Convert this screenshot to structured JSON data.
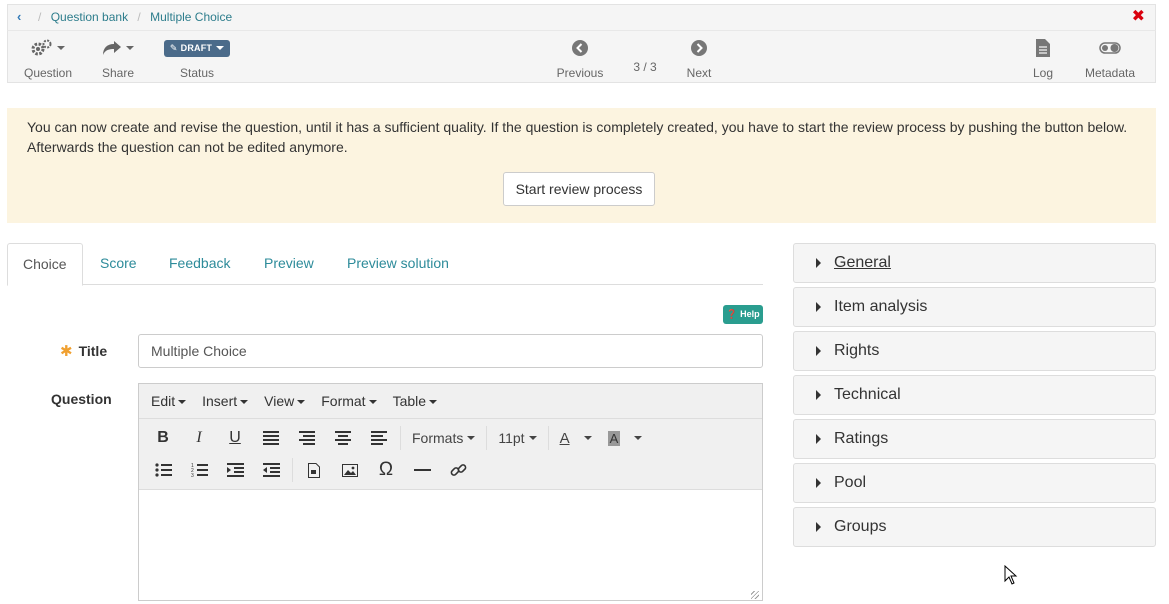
{
  "breadcrumb": {
    "items": [
      "Question bank",
      "Multiple Choice"
    ],
    "separator": "/"
  },
  "toolbar": {
    "question_label": "Question",
    "share_label": "Share",
    "status_badge": "DRAFT",
    "status_label": "Status",
    "previous_label": "Previous",
    "pager": "3 / 3",
    "next_label": "Next",
    "log_label": "Log",
    "metadata_label": "Metadata"
  },
  "notice": {
    "text": "You can now create and revise the question, until it has a sufficient quality. If the question is completely created, you have to start the review process by pushing the button below. Afterwards the question can not be edited anymore.",
    "button_label": "Start review process"
  },
  "tabs": [
    "Choice",
    "Score",
    "Feedback",
    "Preview",
    "Preview solution"
  ],
  "active_tab": "Choice",
  "help_label": "Help",
  "form": {
    "title_label": "Title",
    "title_value": "Multiple Choice",
    "question_label": "Question"
  },
  "editor": {
    "menus": [
      "Edit",
      "Insert",
      "View",
      "Format",
      "Table"
    ],
    "formats_label": "Formats",
    "font_size": "11pt",
    "font_color_glyph": "A",
    "bg_color_glyph": "A"
  },
  "accordion": [
    "General",
    "Item analysis",
    "Rights",
    "Technical",
    "Ratings",
    "Pool",
    "Groups"
  ],
  "colors": {
    "link": "#2d8b9a",
    "notice_bg": "#fcf4e0",
    "draft_badge": "#4b6b8a",
    "help_badge": "#2a9d8f",
    "close": "#d9000d",
    "required_star": "#f0a030"
  }
}
